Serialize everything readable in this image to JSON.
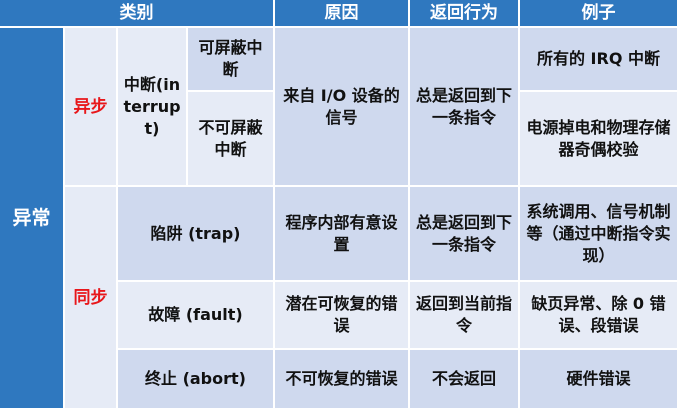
{
  "header": {
    "category": "类别",
    "reason": "原因",
    "return_behavior": "返回行为",
    "example": "例子"
  },
  "side_label": "异常",
  "async": {
    "label": "异步",
    "interrupt": "中断(interrupt)",
    "maskable": "可屏蔽中断",
    "nonmaskable": "不可屏蔽中断",
    "reason": "来自 I/O 设备的信号",
    "return": "总是返回到下一条指令",
    "example_maskable": "所有的 IRQ 中断",
    "example_nonmaskable": "电源掉电和物理存储器奇偶校验"
  },
  "sync": {
    "label": "同步",
    "rows": [
      {
        "type": "陷阱 (trap)",
        "reason": "程序内部有意设置",
        "return": "总是返回到下一条指令",
        "example": "系统调用、信号机制等（通过中断指令实现）"
      },
      {
        "type": "故障 (fault)",
        "reason": "潜在可恢复的错误",
        "return": "返回到当前指令",
        "example": "缺页异常、除 0 错误、段错误"
      },
      {
        "type": "终止 (abort)",
        "reason": "不可恢复的错误",
        "return": "不会返回",
        "example": "硬件错误"
      }
    ]
  }
}
